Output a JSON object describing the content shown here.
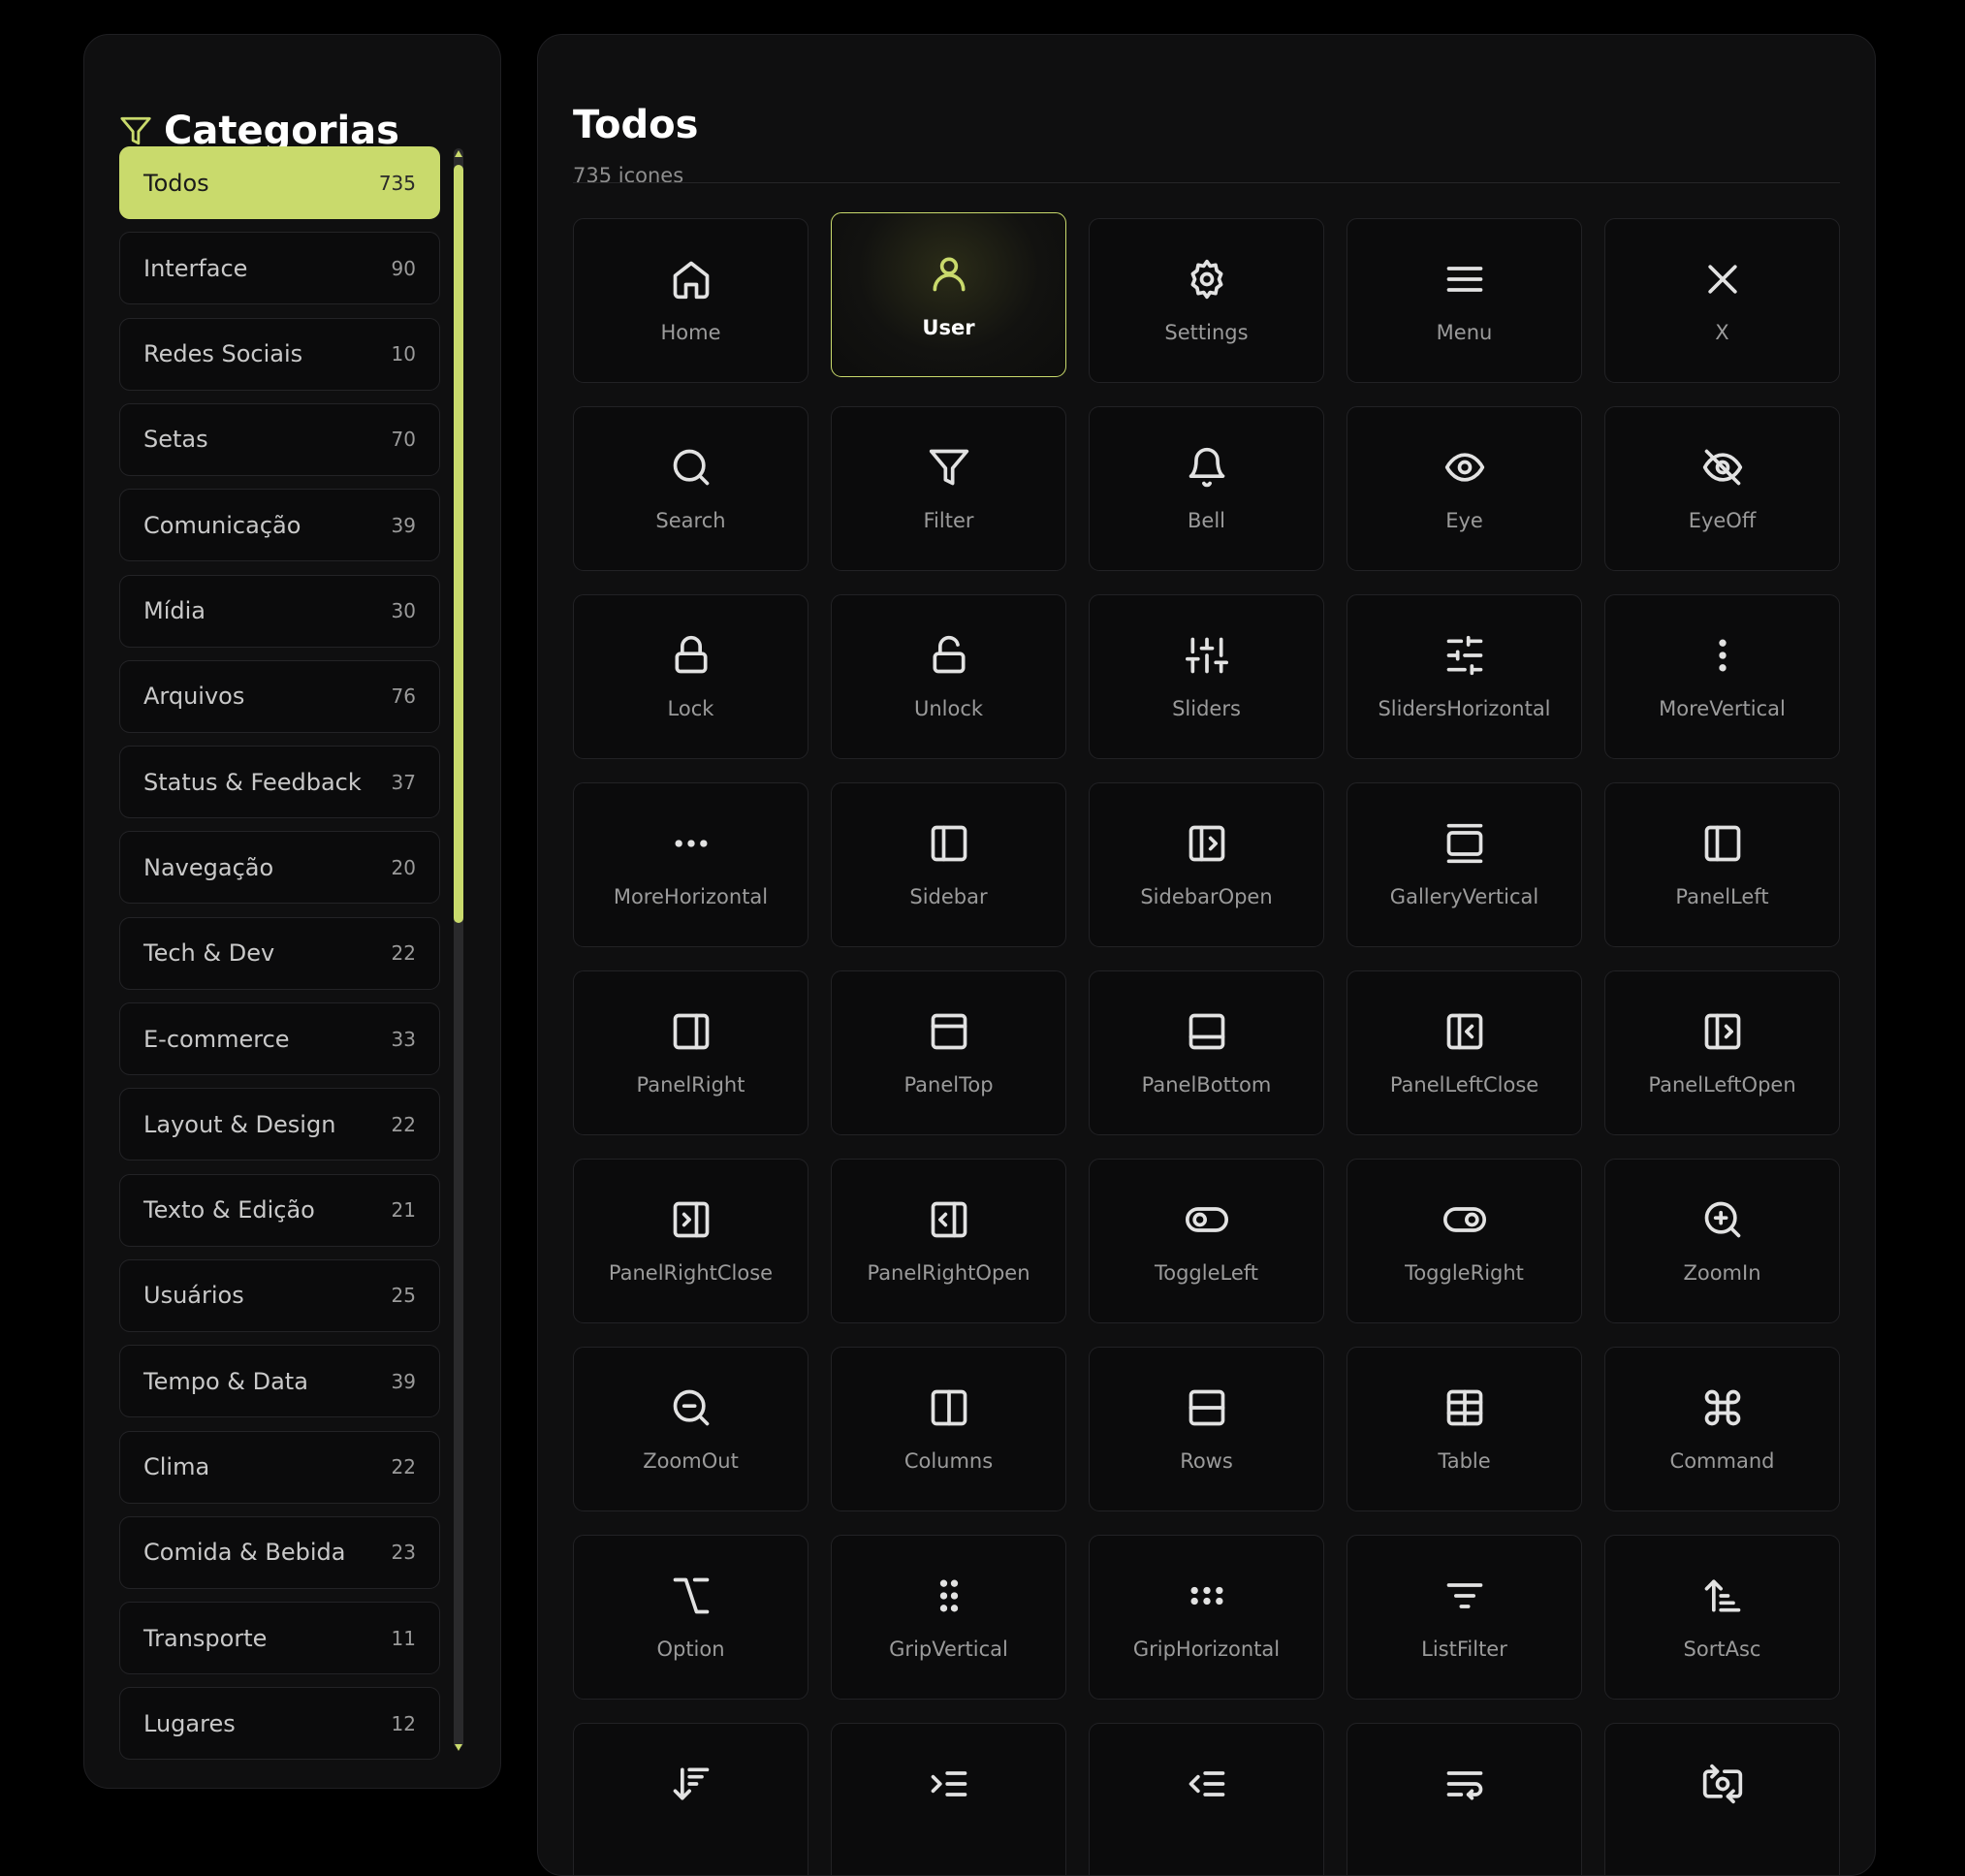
{
  "sidebar": {
    "title": "Categorias",
    "title_icon": "filter-icon",
    "categories": [
      {
        "label": "Todos",
        "count": "735",
        "active": true
      },
      {
        "label": "Interface",
        "count": "90"
      },
      {
        "label": "Redes Sociais",
        "count": "10"
      },
      {
        "label": "Setas",
        "count": "70"
      },
      {
        "label": "Comunicação",
        "count": "39"
      },
      {
        "label": "Mídia",
        "count": "30"
      },
      {
        "label": "Arquivos",
        "count": "76"
      },
      {
        "label": "Status & Feedback",
        "count": "37"
      },
      {
        "label": "Navegação",
        "count": "20"
      },
      {
        "label": "Tech & Dev",
        "count": "22"
      },
      {
        "label": "E-commerce",
        "count": "33"
      },
      {
        "label": "Layout & Design",
        "count": "22"
      },
      {
        "label": "Texto & Edição",
        "count": "21"
      },
      {
        "label": "Usuários",
        "count": "25"
      },
      {
        "label": "Tempo & Data",
        "count": "39"
      },
      {
        "label": "Clima",
        "count": "22"
      },
      {
        "label": "Comida & Bebida",
        "count": "23"
      },
      {
        "label": "Transporte",
        "count": "11"
      },
      {
        "label": "Lugares",
        "count": "12"
      }
    ]
  },
  "main": {
    "title": "Todos",
    "subtitle": "735 icones",
    "selected_icon": "User",
    "icons": [
      {
        "name": "Home",
        "icon": "home-icon"
      },
      {
        "name": "User",
        "icon": "user-icon"
      },
      {
        "name": "Settings",
        "icon": "settings-icon"
      },
      {
        "name": "Menu",
        "icon": "menu-icon"
      },
      {
        "name": "X",
        "icon": "x-icon"
      },
      {
        "name": "Search",
        "icon": "search-icon"
      },
      {
        "name": "Filter",
        "icon": "filter-icon"
      },
      {
        "name": "Bell",
        "icon": "bell-icon"
      },
      {
        "name": "Eye",
        "icon": "eye-icon"
      },
      {
        "name": "EyeOff",
        "icon": "eye-off-icon"
      },
      {
        "name": "Lock",
        "icon": "lock-icon"
      },
      {
        "name": "Unlock",
        "icon": "unlock-icon"
      },
      {
        "name": "Sliders",
        "icon": "sliders-icon"
      },
      {
        "name": "SlidersHorizontal",
        "icon": "sliders-horizontal-icon"
      },
      {
        "name": "MoreVertical",
        "icon": "more-vertical-icon"
      },
      {
        "name": "MoreHorizontal",
        "icon": "more-horizontal-icon"
      },
      {
        "name": "Sidebar",
        "icon": "sidebar-icon"
      },
      {
        "name": "SidebarOpen",
        "icon": "sidebar-open-icon"
      },
      {
        "name": "GalleryVertical",
        "icon": "gallery-vertical-icon"
      },
      {
        "name": "PanelLeft",
        "icon": "panel-left-icon"
      },
      {
        "name": "PanelRight",
        "icon": "panel-right-icon"
      },
      {
        "name": "PanelTop",
        "icon": "panel-top-icon"
      },
      {
        "name": "PanelBottom",
        "icon": "panel-bottom-icon"
      },
      {
        "name": "PanelLeftClose",
        "icon": "panel-left-close-icon"
      },
      {
        "name": "PanelLeftOpen",
        "icon": "panel-left-open-icon"
      },
      {
        "name": "PanelRightClose",
        "icon": "panel-right-close-icon"
      },
      {
        "name": "PanelRightOpen",
        "icon": "panel-right-open-icon"
      },
      {
        "name": "ToggleLeft",
        "icon": "toggle-left-icon"
      },
      {
        "name": "ToggleRight",
        "icon": "toggle-right-icon"
      },
      {
        "name": "ZoomIn",
        "icon": "zoom-in-icon"
      },
      {
        "name": "ZoomOut",
        "icon": "zoom-out-icon"
      },
      {
        "name": "Columns",
        "icon": "columns-icon"
      },
      {
        "name": "Rows",
        "icon": "rows-icon"
      },
      {
        "name": "Table",
        "icon": "table-icon"
      },
      {
        "name": "Command",
        "icon": "command-icon"
      },
      {
        "name": "Option",
        "icon": "option-icon"
      },
      {
        "name": "GripVertical",
        "icon": "grip-vertical-icon"
      },
      {
        "name": "GripHorizontal",
        "icon": "grip-horizontal-icon"
      },
      {
        "name": "ListFilter",
        "icon": "list-filter-icon"
      },
      {
        "name": "SortAsc",
        "icon": "sort-asc-icon"
      },
      {
        "name": "",
        "icon": "sort-desc-icon"
      },
      {
        "name": "",
        "icon": "indent-icon"
      },
      {
        "name": "",
        "icon": "outdent-icon"
      },
      {
        "name": "",
        "icon": "wrap-text-icon"
      },
      {
        "name": "",
        "icon": "switch-camera-icon"
      }
    ]
  },
  "colors": {
    "accent": "#c9da6c",
    "background": "#000000",
    "panel": "#0f0f10",
    "tile": "#0b0b0c"
  }
}
